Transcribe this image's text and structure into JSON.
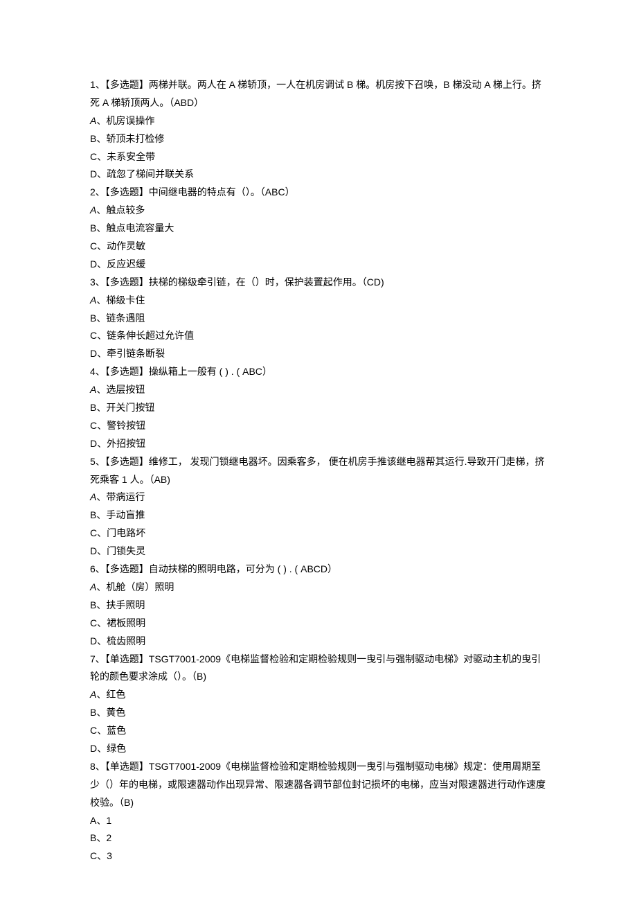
{
  "questions": [
    {
      "num": "1",
      "header": "、【多选题】两梯并联。两人在 A 梯轿顶，一人在机房调试 B 梯。机房按下召唤，B 梯没动 A 梯上行。挤死 A 梯轿顶两人。（ABD）",
      "options": [
        {
          "label": "A",
          "italic": true,
          "text": "、机房误操作"
        },
        {
          "label": "B",
          "italic": false,
          "text": "、轿顶未打检修"
        },
        {
          "label": "C",
          "italic": false,
          "text": "、未系安全带"
        },
        {
          "label": "D",
          "italic": false,
          "text": "、疏忽了梯间并联关系"
        }
      ]
    },
    {
      "num": "2",
      "header": "、【多选题】中间继电器的特点有（）。（ABC）",
      "options": [
        {
          "label": "A",
          "italic": true,
          "text": "、触点较多"
        },
        {
          "label": "B",
          "italic": false,
          "text": "、触点电流容量大"
        },
        {
          "label": "C",
          "italic": false,
          "text": "、动作灵敏"
        },
        {
          "label": "D",
          "italic": false,
          "text": "、反应迟缓"
        }
      ]
    },
    {
      "num": "3",
      "header": "、【多选题】扶梯的梯级牵引链，在（）时，保护装置起作用。（CD)",
      "options": [
        {
          "label": "A",
          "italic": true,
          "text": "、梯级卡住"
        },
        {
          "label": "B",
          "italic": false,
          "text": "、链条遇阻"
        },
        {
          "label": "C",
          "italic": false,
          "text": "、链条伸长超过允许值"
        },
        {
          "label": "D",
          "italic": false,
          "text": "、牵引链条断裂"
        }
      ]
    },
    {
      "num": "4",
      "header": "、【多选题】操纵箱上一般有 ( ) . ( ABC）",
      "options": [
        {
          "label": "A",
          "italic": true,
          "text": "、选层按钮"
        },
        {
          "label": "B",
          "italic": false,
          "text": "、开关门按钮"
        },
        {
          "label": "C",
          "italic": false,
          "text": "、警铃按钮"
        },
        {
          "label": "D",
          "italic": false,
          "text": "、外招按钮"
        }
      ]
    },
    {
      "num": "5",
      "header": "、【多选题】维修工， 发现门锁继电器坏。因乘客多， 便在机房手推该继电器帮其运行.导致开门走梯，挤死乘客 1 人。（AB)",
      "options": [
        {
          "label": "A",
          "italic": true,
          "text": "、带病运行"
        },
        {
          "label": "B",
          "italic": false,
          "text": "、手动盲推"
        },
        {
          "label": "C",
          "italic": false,
          "text": "、门电路坏"
        },
        {
          "label": "D",
          "italic": false,
          "text": "、门锁失灵"
        }
      ]
    },
    {
      "num": "6",
      "header": "、【多选题】自动扶梯的照明电路，可分为 ( ) . ( ABCD）",
      "options": [
        {
          "label": "A",
          "italic": true,
          "text": "、机舱（房）照明"
        },
        {
          "label": "B",
          "italic": false,
          "text": "、扶手照明"
        },
        {
          "label": "C",
          "italic": false,
          "text": "、裙板照明"
        },
        {
          "label": "D",
          "italic": false,
          "text": "、梳齿照明"
        }
      ]
    },
    {
      "num": "7",
      "header": "、【单选题】TSGT7001-2009《电梯监督检验和定期检验规则一曳引与强制驱动电梯》对驱动主机的曳引轮的颜色要求涂成（）。（B)",
      "options": [
        {
          "label": "A",
          "italic": true,
          "text": "、红色"
        },
        {
          "label": "B",
          "italic": false,
          "text": "、黄色"
        },
        {
          "label": "C",
          "italic": false,
          "text": "、蓝色"
        },
        {
          "label": "D",
          "italic": false,
          "text": "、绿色"
        }
      ]
    },
    {
      "num": "8",
      "header": "、【单选题】TSGT7001-2009《电梯监督检验和定期检验规则一曳引与强制驱动电梯》规定：使用周期至少（）年的电梯，或限速器动作出现异常、限速器各调节部位封记损坏的电梯，应当对限速器进行动作速度校验。（B)",
      "options": [
        {
          "label": "A",
          "italic": false,
          "text": "、1"
        },
        {
          "label": "B",
          "italic": false,
          "text": "、2"
        },
        {
          "label": "C",
          "italic": false,
          "text": "、3"
        }
      ]
    }
  ]
}
